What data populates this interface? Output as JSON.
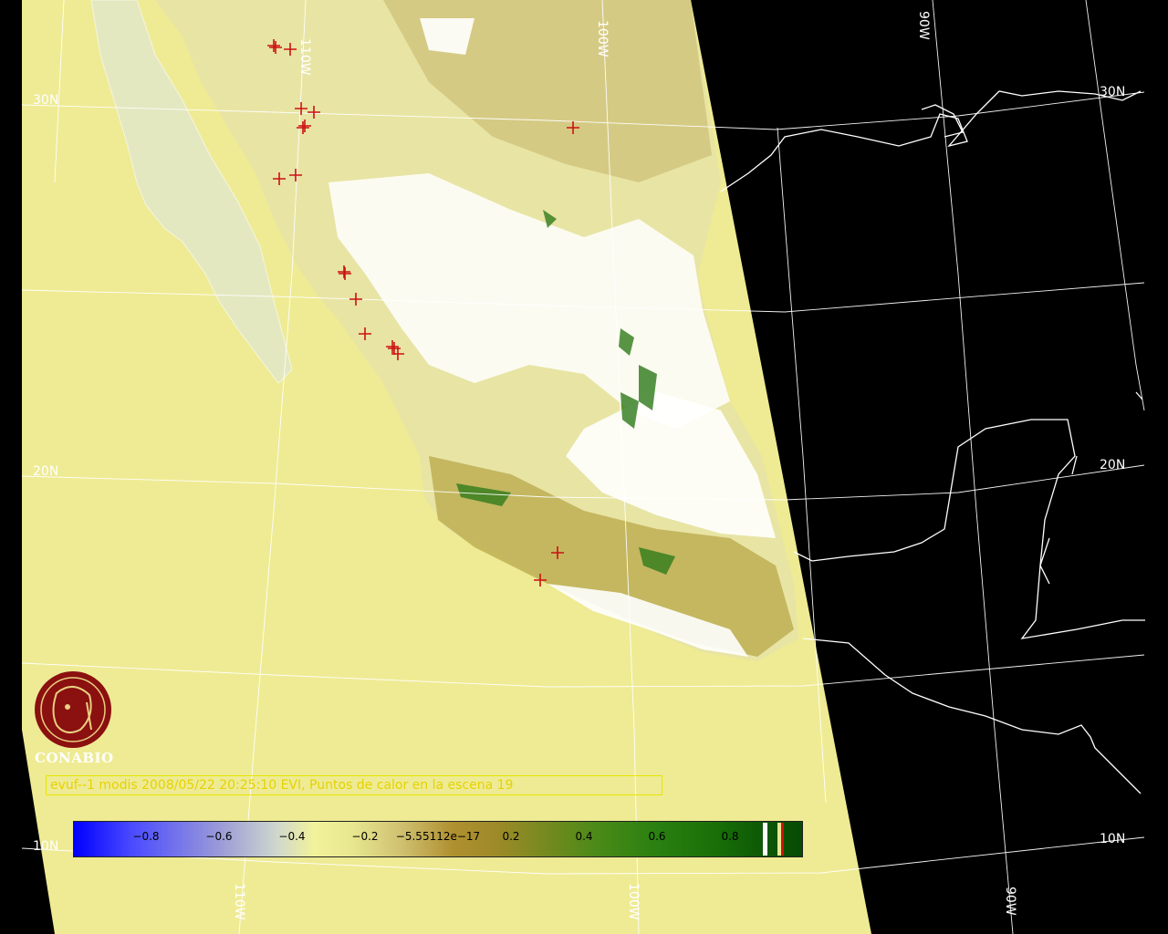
{
  "logo": {
    "text": "CONABIO"
  },
  "caption": "evuf--1 modis 2008/05/22 20:25:10 EVI, Puntos de calor en la escena 19",
  "grid_labels": {
    "lat_30": "30N",
    "lat_30_right": "30N",
    "lat_20": "20N",
    "lat_20_right": "20N",
    "lat_10": "10N",
    "lat_10_right": "10N",
    "lon_110_top": "110W",
    "lon_100_top": "100W",
    "lon_90_top": "90W",
    "lon_110_bottom": "110W",
    "lon_100_bottom": "100W",
    "lon_90_bottom": "90W"
  },
  "colorbar": {
    "ticks": [
      "−0.8",
      "−0.6",
      "−0.4",
      "−0.2",
      "−5.55112e−17",
      "0.2",
      "0.4",
      "0.6",
      "0.8"
    ],
    "tick_values": [
      -0.8,
      -0.6,
      -0.4,
      -0.2,
      0,
      0.2,
      0.4,
      0.6,
      0.8
    ],
    "range": [
      -1,
      1
    ]
  },
  "colors": {
    "background": "#000000",
    "sea": "#eeeb94",
    "land_light": "#f2f0b0",
    "land_olive": "#b8a84a",
    "vegetation_green": "#2f7a1a",
    "cloud_white": "#ffffff",
    "hotspot": "#cc1111",
    "grid": "#ffffff",
    "caption": "#e6d200",
    "logo": "#8b1010"
  },
  "hotspot_count": 19
}
